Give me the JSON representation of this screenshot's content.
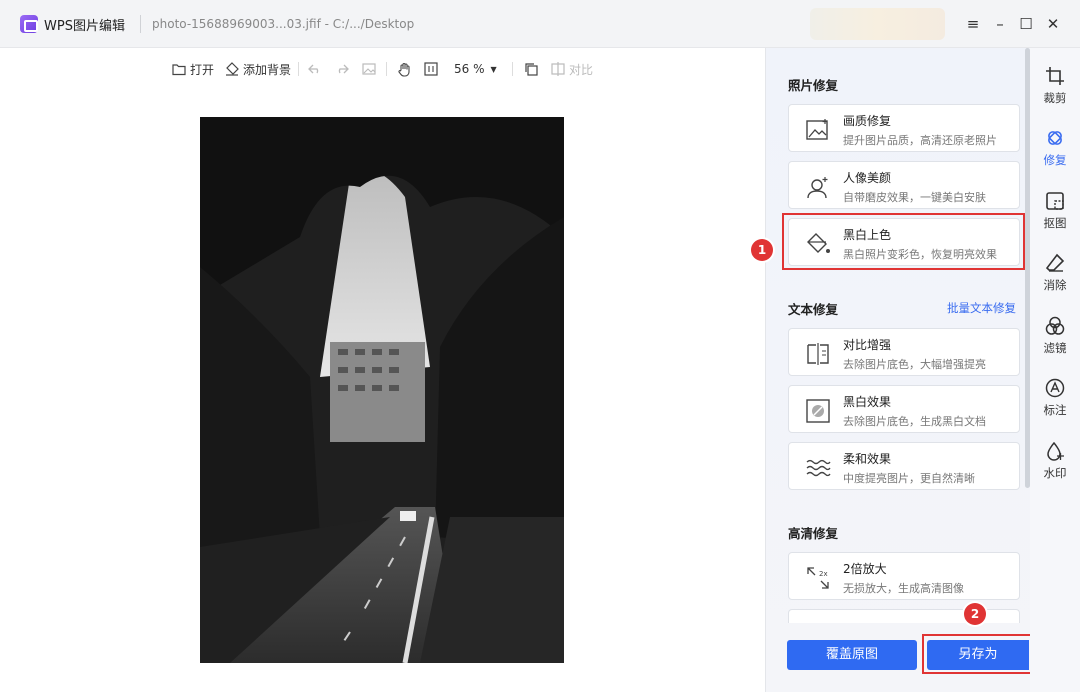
{
  "titlebar": {
    "app_name": "WPS图片编辑",
    "file_path": "photo-15688969003...03.jfif - C:/.../Desktop"
  },
  "toolbar": {
    "open": "打开",
    "add_background": "添加背景",
    "zoom": "56 %",
    "compare": "对比"
  },
  "panel": {
    "photo_repair": {
      "title": "照片修复",
      "items": [
        {
          "title": "画质修复",
          "desc": "提升图片品质，高清还原老照片",
          "icon": "image-quality-icon"
        },
        {
          "title": "人像美颜",
          "desc": "自带磨皮效果，一键美白安肤",
          "icon": "portrait-icon"
        },
        {
          "title": "黑白上色",
          "desc": "黑白照片变彩色，恢复明亮效果",
          "icon": "paint-bucket-icon"
        }
      ]
    },
    "text_repair": {
      "title": "文本修复",
      "link": "批量文本修复",
      "items": [
        {
          "title": "对比增强",
          "desc": "去除图片底色，大幅增强提亮",
          "icon": "contrast-icon"
        },
        {
          "title": "黑白效果",
          "desc": "去除图片底色，生成黑白文档",
          "icon": "bw-effect-icon"
        },
        {
          "title": "柔和效果",
          "desc": "中度提亮图片，更自然清晰",
          "icon": "soft-effect-icon"
        }
      ]
    },
    "hd_repair": {
      "title": "高清修复",
      "items": [
        {
          "title": "2倍放大",
          "desc": "无损放大，生成高清图像",
          "icon": "upscale-icon"
        }
      ]
    },
    "badge1": "1",
    "badge2": "2",
    "overwrite_button": "覆盖原图",
    "save_as_button": "另存为"
  },
  "sidenav": {
    "items": [
      {
        "label": "裁剪",
        "icon": "crop-icon"
      },
      {
        "label": "修复",
        "icon": "repair-icon"
      },
      {
        "label": "抠图",
        "icon": "cutout-icon"
      },
      {
        "label": "消除",
        "icon": "eraser-icon"
      },
      {
        "label": "滤镜",
        "icon": "filter-icon"
      },
      {
        "label": "标注",
        "icon": "annotate-icon"
      },
      {
        "label": "水印",
        "icon": "watermark-icon"
      }
    ]
  },
  "colors": {
    "accent": "#2f6af2",
    "highlight": "#e03434"
  }
}
